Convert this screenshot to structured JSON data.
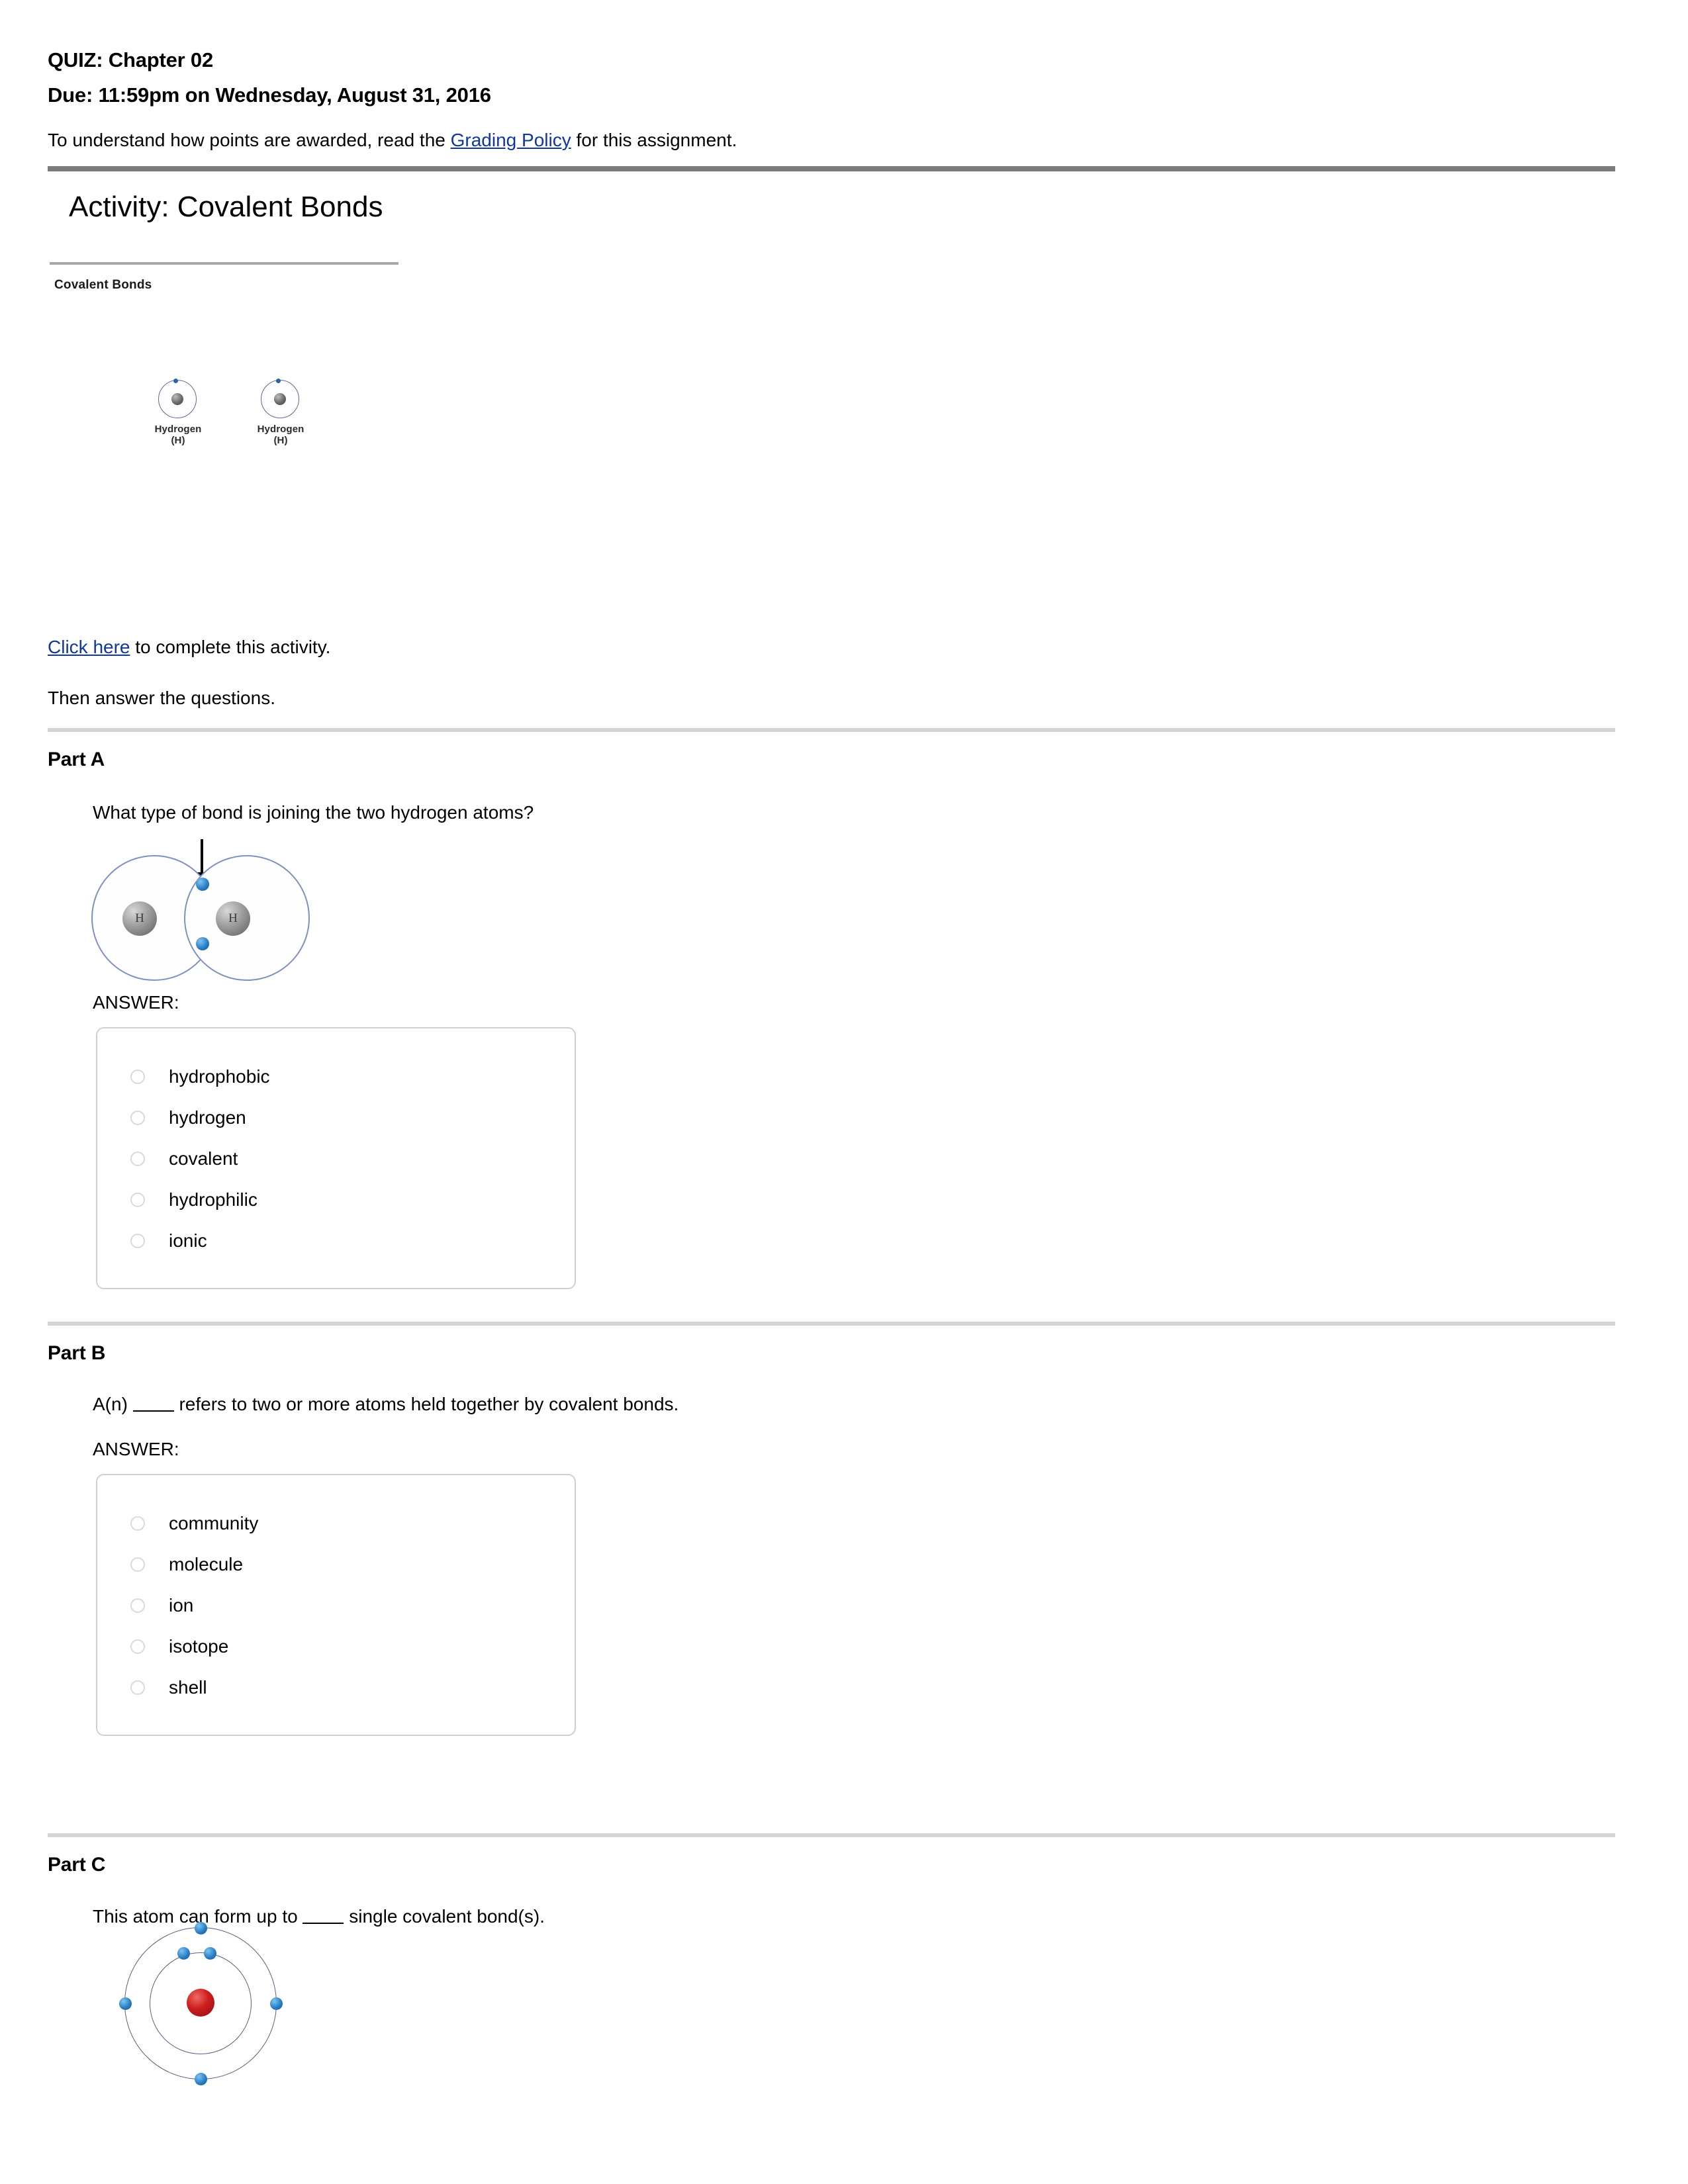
{
  "header": {
    "quiz_title": "QUIZ: Chapter 02",
    "due_line": "Due: 11:59pm on Wednesday, August 31, 2016",
    "grading_prefix": "To understand how points are awarded, read the ",
    "grading_link": "Grading Policy",
    "grading_suffix": " for this assignment."
  },
  "activity": {
    "title": "Activity: Covalent Bonds",
    "subtitle": "Covalent Bonds",
    "hydrogen_atoms": [
      {
        "label": "Hydrogen (H)"
      },
      {
        "label": "Hydrogen (H)"
      }
    ],
    "click_link": "Click here",
    "click_suffix": " to complete this activity.",
    "then_line": "Then answer the questions."
  },
  "parts": [
    {
      "label": "Part A",
      "question": "What type of bond is joining the two hydrogen atoms?",
      "answer_label": "ANSWER:",
      "options": [
        "hydrophobic",
        "hydrogen",
        "covalent",
        "hydrophilic",
        "ionic"
      ],
      "figure": {
        "type": "h2-molecule",
        "atom_symbol_left": "H",
        "atom_symbol_right": "H"
      }
    },
    {
      "label": "Part B",
      "question_prefix": "A(n) ",
      "question_suffix": " refers to two or more atoms held together by covalent bonds.",
      "answer_label": "ANSWER:",
      "options": [
        "community",
        "molecule",
        "ion",
        "isotope",
        "shell"
      ]
    },
    {
      "label": "Part C",
      "question_prefix": "This atom can form up to ",
      "question_suffix": " single covalent bond(s).",
      "figure": {
        "type": "bohr-atom",
        "inner_shell_electrons": 2,
        "outer_shell_electrons": 4
      }
    }
  ],
  "colors": {
    "link": "#11379b",
    "rule_thick": "#7c7c7c",
    "rule_part": "#d4d4d4",
    "answer_box_border": "#d0d0d0",
    "electron": "#2a7fc4",
    "nucleus_red": "#cc1d1d"
  }
}
